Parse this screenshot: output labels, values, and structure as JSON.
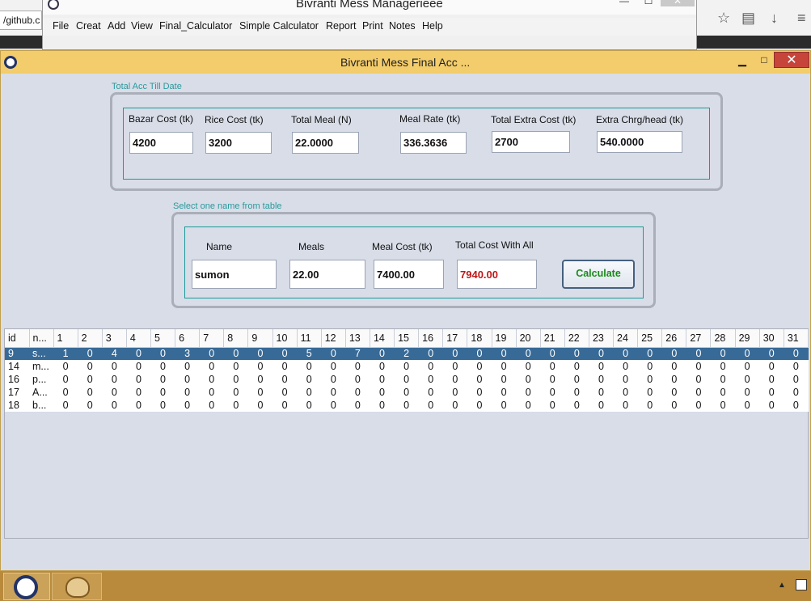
{
  "browser": {
    "url_fragment": "/github.c",
    "icons": [
      "star-icon",
      "reading-list-icon",
      "download-icon",
      "menu-icon"
    ]
  },
  "bg_app": {
    "title": "Bivranti Mess Managerieee",
    "menu": [
      "File",
      "Creat",
      "Add",
      "View",
      "Final_Calculator",
      "Simple Calculator",
      "Report",
      "Print",
      "Notes",
      "Help"
    ],
    "controls": [
      "—",
      "☐",
      "✕"
    ]
  },
  "window": {
    "title": "Bivranti Mess Final Acc ...",
    "min": "▁",
    "max": "□",
    "close": "✕"
  },
  "summary": {
    "group_title": "Total Acc Till Date",
    "fields": [
      {
        "label": "Bazar Cost (tk)",
        "value": "4200"
      },
      {
        "label": "Rice Cost (tk)",
        "value": "3200"
      },
      {
        "label": "Total Meal (N)",
        "value": "22.0000"
      },
      {
        "label": "Meal Rate (tk)",
        "value": "336.3636"
      },
      {
        "label": "Total Extra Cost (tk)",
        "value": "2700"
      },
      {
        "label": "Extra Chrg/head (tk)",
        "value": "540.0000"
      }
    ]
  },
  "select": {
    "group_title": "Select one name from table",
    "fields": [
      {
        "label": "Name",
        "value": "sumon"
      },
      {
        "label": "Meals",
        "value": "22.00"
      },
      {
        "label": "Meal Cost (tk)",
        "value": "7400.00"
      },
      {
        "label": "Total Cost With All",
        "value": "7940.00"
      }
    ],
    "calculate_label": "Calculate"
  },
  "table": {
    "columns": [
      "id",
      "n...",
      "1",
      "2",
      "3",
      "4",
      "5",
      "6",
      "7",
      "8",
      "9",
      "10",
      "11",
      "12",
      "13",
      "14",
      "15",
      "16",
      "17",
      "18",
      "19",
      "20",
      "21",
      "22",
      "23",
      "24",
      "25",
      "26",
      "27",
      "28",
      "29",
      "30",
      "31"
    ],
    "rows": [
      [
        "9",
        "s...",
        "1",
        "0",
        "4",
        "0",
        "0",
        "3",
        "0",
        "0",
        "0",
        "0",
        "5",
        "0",
        "7",
        "0",
        "2",
        "0",
        "0",
        "0",
        "0",
        "0",
        "0",
        "0",
        "0",
        "0",
        "0",
        "0",
        "0",
        "0",
        "0",
        "0",
        "0"
      ],
      [
        "14",
        "m...",
        "0",
        "0",
        "0",
        "0",
        "0",
        "0",
        "0",
        "0",
        "0",
        "0",
        "0",
        "0",
        "0",
        "0",
        "0",
        "0",
        "0",
        "0",
        "0",
        "0",
        "0",
        "0",
        "0",
        "0",
        "0",
        "0",
        "0",
        "0",
        "0",
        "0",
        "0"
      ],
      [
        "16",
        "p...",
        "0",
        "0",
        "0",
        "0",
        "0",
        "0",
        "0",
        "0",
        "0",
        "0",
        "0",
        "0",
        "0",
        "0",
        "0",
        "0",
        "0",
        "0",
        "0",
        "0",
        "0",
        "0",
        "0",
        "0",
        "0",
        "0",
        "0",
        "0",
        "0",
        "0",
        "0"
      ],
      [
        "17",
        "A...",
        "0",
        "0",
        "0",
        "0",
        "0",
        "0",
        "0",
        "0",
        "0",
        "0",
        "0",
        "0",
        "0",
        "0",
        "0",
        "0",
        "0",
        "0",
        "0",
        "0",
        "0",
        "0",
        "0",
        "0",
        "0",
        "0",
        "0",
        "0",
        "0",
        "0",
        "0"
      ],
      [
        "18",
        "b...",
        "0",
        "0",
        "0",
        "0",
        "0",
        "0",
        "0",
        "0",
        "0",
        "0",
        "0",
        "0",
        "0",
        "0",
        "0",
        "0",
        "0",
        "0",
        "0",
        "0",
        "0",
        "0",
        "0",
        "0",
        "0",
        "0",
        "0",
        "0",
        "0",
        "0",
        "0"
      ]
    ],
    "selected_row": 0
  },
  "colors": {
    "title_bar": "#f3cc6b",
    "accent_teal": "#2a9a9c",
    "selected_row": "#386a97",
    "total_red": "#c01818",
    "calc_green": "#1c8a1c"
  },
  "taskbar": {
    "apps": [
      "mess-manager-app-icon",
      "paint-app-icon"
    ],
    "tray": "▲"
  }
}
